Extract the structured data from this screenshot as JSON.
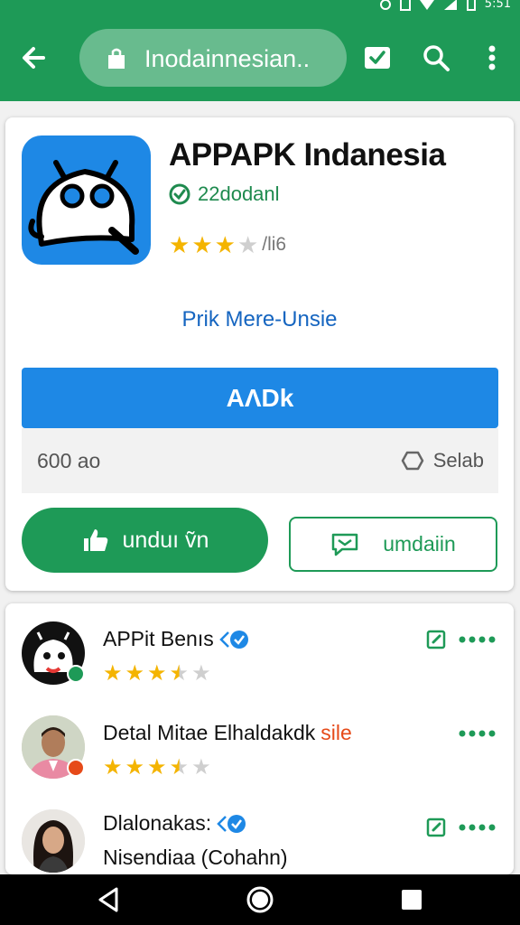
{
  "status_bar": {
    "time": "5:51"
  },
  "app_bar": {
    "url_text": "Inodainnesian..",
    "icons": [
      "back-arrow-icon",
      "shopping-bag-icon",
      "check-box-icon",
      "search-icon",
      "more-vert-icon"
    ]
  },
  "app_card": {
    "title": "APPAPK Indanesia",
    "verified_label": "22dodanl",
    "rating": {
      "stars": 3,
      "text": "/li6"
    },
    "link_text": "Prik Mere-Unsie",
    "primary_button": "AΛDk",
    "info_left": "600 ao",
    "info_right": "Selab",
    "download_button": "unduı ṽn",
    "secondary_button": "umdaiin",
    "colors": {
      "accent": "#1e9a57",
      "primary": "#1e88e5",
      "star": "#f4b400"
    }
  },
  "list": {
    "items": [
      {
        "title": "APPit Benıs",
        "rating": 3.5,
        "avatar": "robot-avatar"
      },
      {
        "title": "Detal Mitae Elhaldakdk",
        "title_highlight": "sile",
        "rating": 3.5,
        "avatar": "man-photo-avatar"
      },
      {
        "title": "Dlalonakas:",
        "subtitle": "Nisendiaa (Cohahn)",
        "avatar": "woman-photo-avatar"
      }
    ]
  },
  "nav_bar": {
    "icons": [
      "back-triangle-icon",
      "home-circle-icon",
      "recents-square-icon"
    ]
  }
}
